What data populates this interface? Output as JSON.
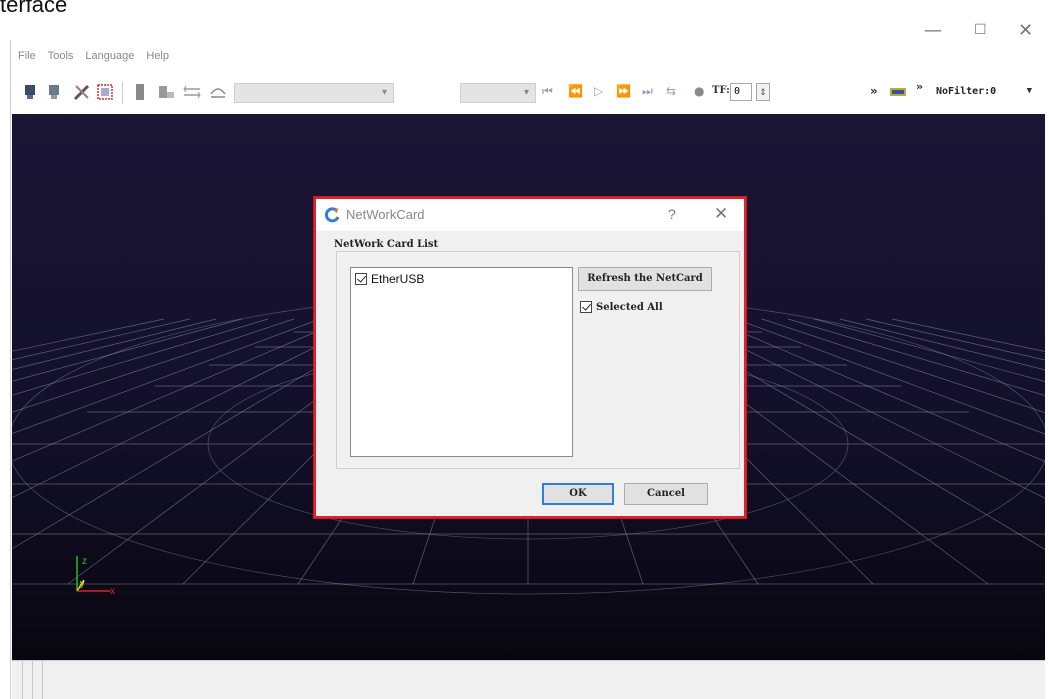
{
  "caption": "terface",
  "window_controls": {
    "minimize": "—",
    "maximize": "☐",
    "close": "✕"
  },
  "menu": {
    "items": [
      "File",
      "Tools",
      "Language",
      "Help"
    ]
  },
  "toolbar": {
    "icons": [
      "connect-icon",
      "disconnect-icon",
      "tools-icon",
      "select-region-icon",
      "device-icon",
      "record-icon",
      "align-icon",
      "calibrate-icon"
    ],
    "player": {
      "first": "⏮",
      "prev": "⏪",
      "play": "▷",
      "next": "⏩",
      "last": "⏭",
      "loop": "⇆",
      "dot": "●"
    },
    "tf_label": "TF:",
    "tf_value": "0",
    "tf_spin": "⇕",
    "more": "»",
    "more2": "»",
    "filter_value": "NoFilter:0",
    "filter_arrow": "▼",
    "dropdown_arrow": "▾"
  },
  "viewport": {
    "axis_labels": {
      "z": "z",
      "y": "y",
      "x": "x"
    },
    "colors": {
      "grid": "#a0a0b8",
      "x_axis": "#e02020",
      "y_axis": "#e0e020",
      "z_axis": "#20c020"
    }
  },
  "dialog": {
    "title": "NetWorkCard",
    "help": "?",
    "close": "✕",
    "group_label": "NetWork Card List",
    "cards": [
      {
        "label": "EtherUSB",
        "checked": true
      }
    ],
    "refresh_button": "Refresh the NetCard",
    "select_all_label": "Selected All",
    "select_all_checked": true,
    "ok_button": "OK",
    "cancel_button": "Cancel",
    "border_color": "#e0222a"
  }
}
